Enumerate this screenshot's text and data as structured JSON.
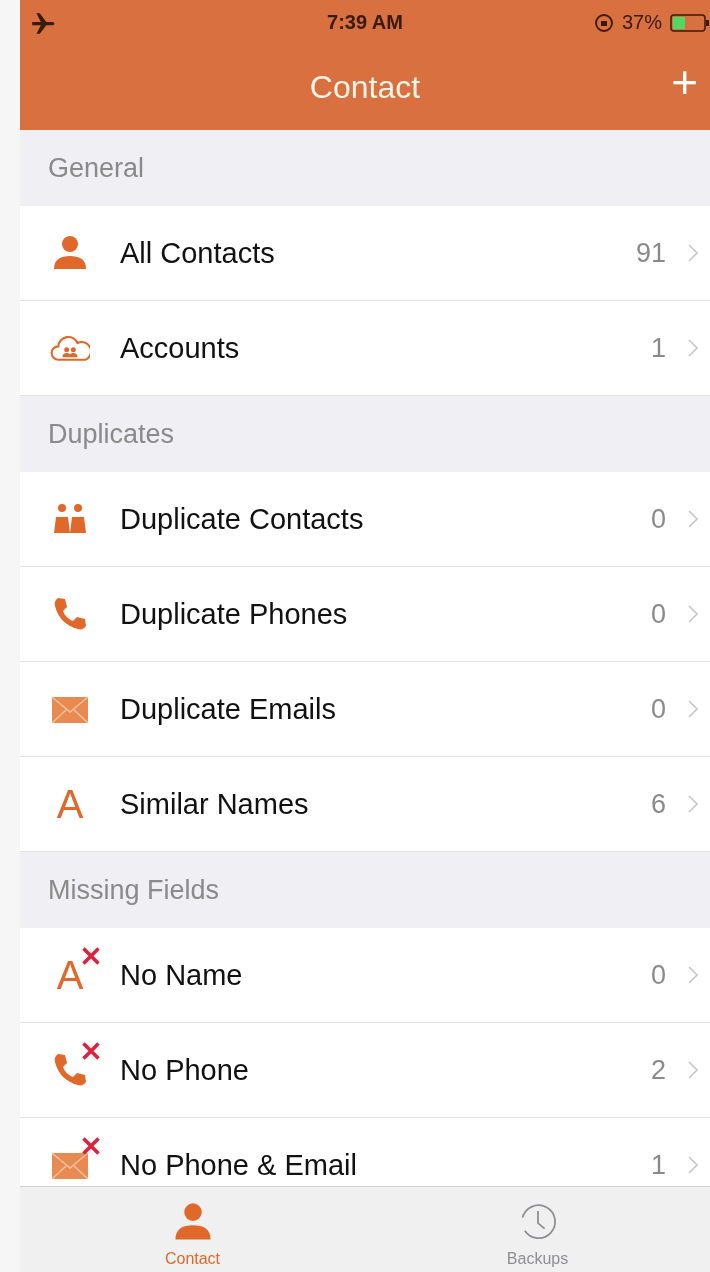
{
  "status_bar": {
    "time": "7:39 AM",
    "battery": "37%"
  },
  "nav": {
    "title": "Contact",
    "add": "+"
  },
  "sections": [
    {
      "title": "General",
      "rows": [
        {
          "kind": "person",
          "label": "All Contacts",
          "count": "91",
          "missing": false
        },
        {
          "kind": "cloud",
          "label": "Accounts",
          "count": "1",
          "missing": false
        }
      ]
    },
    {
      "title": "Duplicates",
      "rows": [
        {
          "kind": "people",
          "label": "Duplicate Contacts",
          "count": "0",
          "missing": false
        },
        {
          "kind": "phone",
          "label": "Duplicate Phones",
          "count": "0",
          "missing": false
        },
        {
          "kind": "mail",
          "label": "Duplicate Emails",
          "count": "0",
          "missing": false
        },
        {
          "kind": "letter",
          "glyph": "A",
          "label": "Similar Names",
          "count": "6",
          "missing": false
        }
      ]
    },
    {
      "title": "Missing Fields",
      "rows": [
        {
          "kind": "letter",
          "glyph": "A",
          "label": "No Name",
          "count": "0",
          "missing": true
        },
        {
          "kind": "phone",
          "label": "No Phone",
          "count": "2",
          "missing": true
        },
        {
          "kind": "mail",
          "label": "No Phone & Email",
          "count": "1",
          "missing": true
        }
      ]
    }
  ],
  "tabs": [
    {
      "kind": "person",
      "label": "Contact",
      "selected": true
    },
    {
      "kind": "clock",
      "label": "Backups",
      "selected": false
    }
  ]
}
